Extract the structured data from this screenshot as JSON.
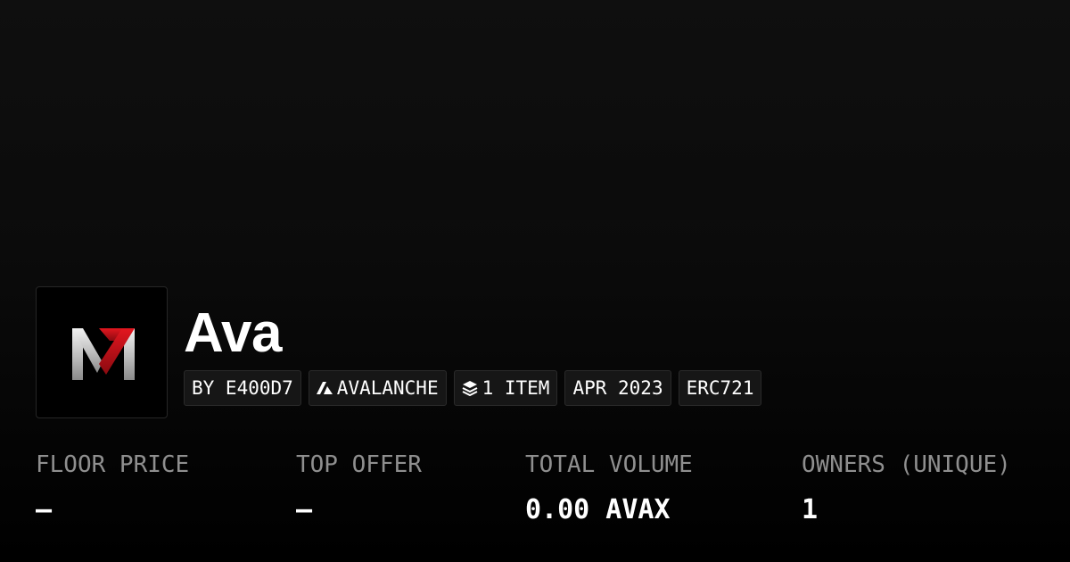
{
  "collection": {
    "title": "Ava",
    "logo_icon": "m7-logo-icon"
  },
  "tags": [
    {
      "label": "BY E400D7",
      "icon": null
    },
    {
      "label": "AVALANCHE",
      "icon": "avalanche-icon"
    },
    {
      "label": "1 ITEM",
      "icon": "layers-icon"
    },
    {
      "label": "APR 2023",
      "icon": null
    },
    {
      "label": "ERC721",
      "icon": null
    }
  ],
  "stats": [
    {
      "label": "FLOOR PRICE",
      "value": "–"
    },
    {
      "label": "TOP OFFER",
      "value": "–"
    },
    {
      "label": "TOTAL VOLUME",
      "value": "0.00 AVAX"
    },
    {
      "label": "OWNERS (UNIQUE)",
      "value": "1"
    }
  ],
  "colors": {
    "background": "#0b0b0b",
    "tag_background": "#161616",
    "label_gray": "#8f8f8f",
    "logo_red": "#c8101a",
    "logo_silver": "#d9d9d9"
  }
}
